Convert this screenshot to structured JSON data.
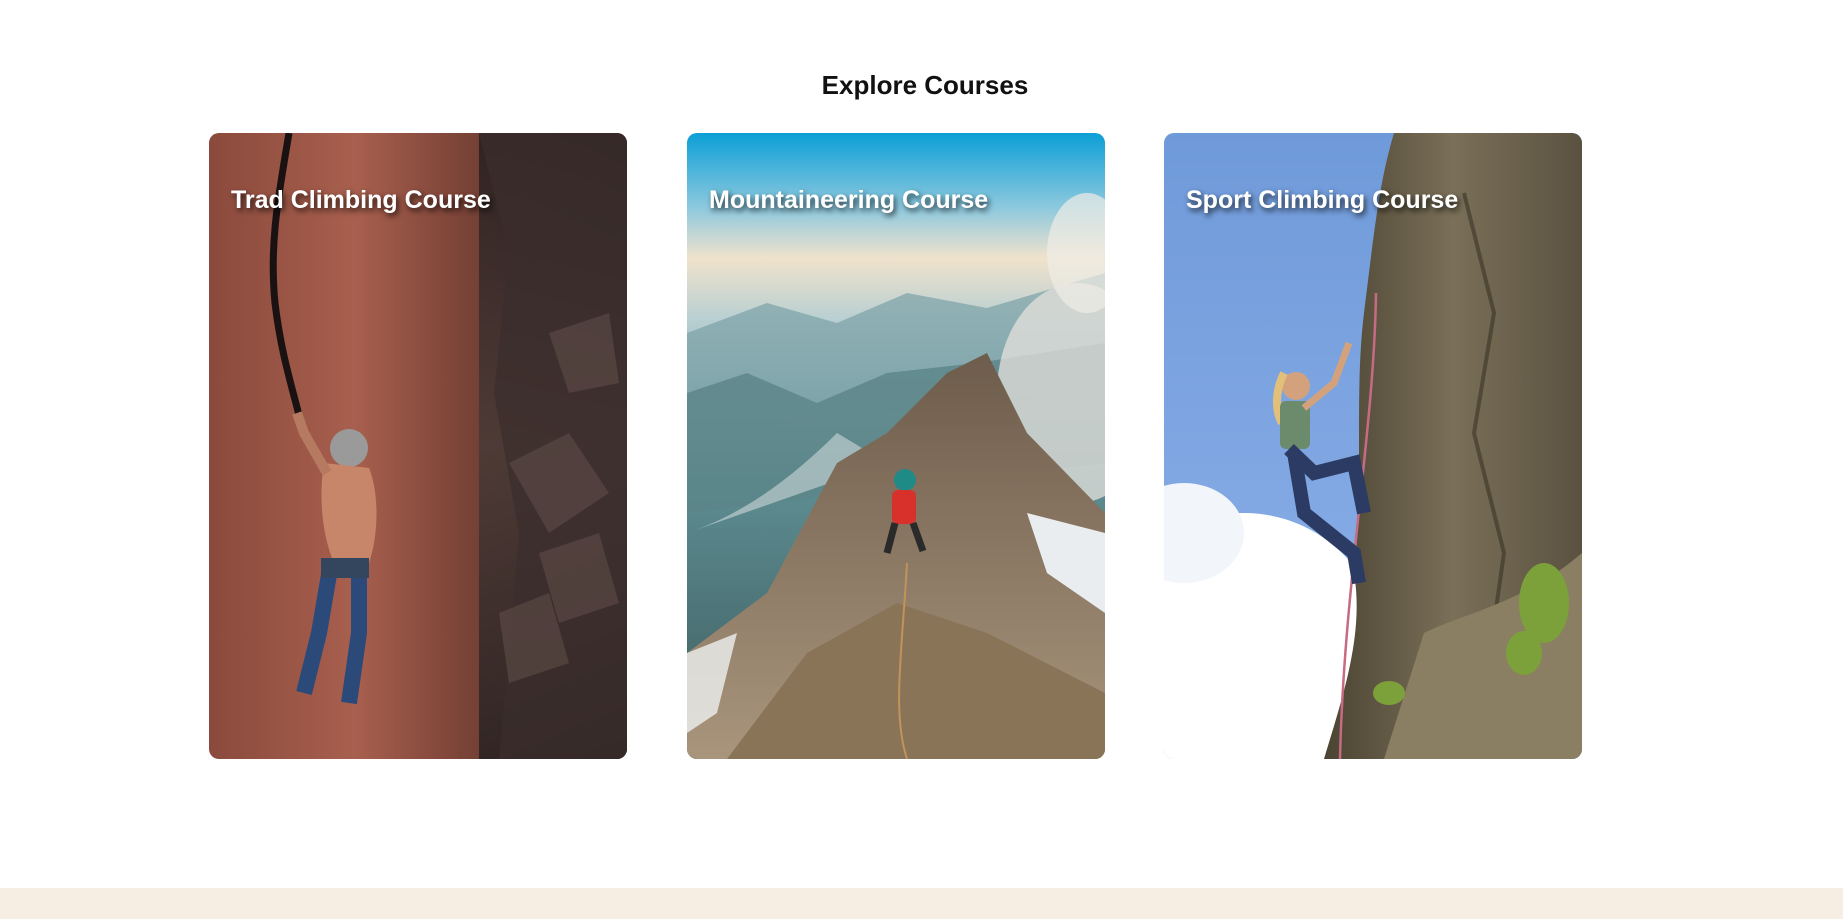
{
  "section": {
    "title": "Explore Courses"
  },
  "courses": [
    {
      "title": "Trad Climbing Course",
      "image": "trad-climbing-photo"
    },
    {
      "title": "Mountaineering Course",
      "image": "mountaineering-photo"
    },
    {
      "title": "Sport Climbing Course",
      "image": "sport-climbing-photo"
    }
  ],
  "colors": {
    "footer_background": "#f6ede3",
    "title_text": "#111111",
    "card_title_text": "#ffffff"
  }
}
